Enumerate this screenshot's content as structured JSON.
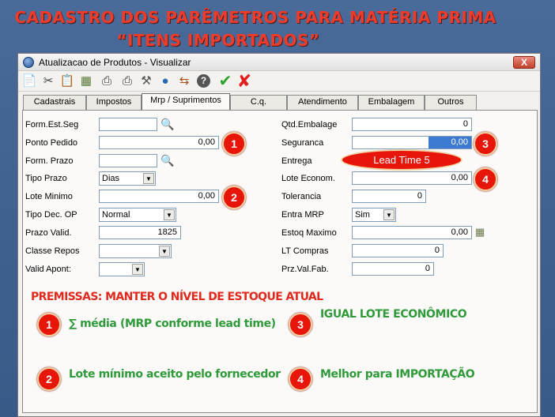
{
  "slide": {
    "title_line1": "CADASTRO DOS PARÊMETROS  PARA MATÉRIA PRIMA",
    "title_line2": "“ITENS IMPORTADOS”"
  },
  "window": {
    "title": "Atualizacao de Produtos - Visualizar",
    "close_label": "X"
  },
  "toolbar": {
    "icons": [
      "document-icon",
      "scissors-icon",
      "clipboard-icon",
      "money-icon",
      "printer-icon",
      "tools-icon",
      "globe-icon",
      "transfer-icon",
      "help-icon",
      "confirm-check-icon",
      "cancel-x-icon"
    ]
  },
  "tabs": [
    "Cadastrais",
    "Impostos",
    "Mrp / Suprimentos",
    "C.q.",
    "Atendimento",
    "Embalagem",
    "Outros"
  ],
  "active_tab": "Mrp / Suprimentos",
  "left_fields": {
    "form_est_seg": {
      "label": "Form.Est.Seg",
      "value": ""
    },
    "ponto_pedido": {
      "label": "Ponto Pedido",
      "value": "0,00"
    },
    "form_prazo": {
      "label": "Form. Prazo",
      "value": ""
    },
    "tipo_prazo": {
      "label": "Tipo Prazo",
      "value": "Dias"
    },
    "lote_minimo": {
      "label": "Lote Minimo",
      "value": "0,00"
    },
    "tipo_dec_op": {
      "label": "Tipo Dec. OP",
      "value": "Normal"
    },
    "prazo_valid": {
      "label": "Prazo Valid.",
      "value": "1825"
    },
    "classe_repos": {
      "label": "Classe Repos",
      "value": ""
    },
    "valid_apont": {
      "label": "Valid Apont:",
      "value": ""
    }
  },
  "right_fields": {
    "qtd_embalage": {
      "label": "Qtd.Embalage",
      "value": "0"
    },
    "seguranca": {
      "label": "Seguranca",
      "value": "0,00"
    },
    "entrega": {
      "label": "Entrega",
      "value": ""
    },
    "lote_econom": {
      "label": "Lote Econom.",
      "value": "0,00"
    },
    "tolerancia": {
      "label": "Tolerancia",
      "value": "0"
    },
    "entra_mrp": {
      "label": "Entra MRP",
      "value": "Sim"
    },
    "estoq_maximo": {
      "label": "Estoq Maximo",
      "value": "0,00"
    },
    "lt_compras": {
      "label": "LT Compras",
      "value": "0"
    },
    "prz_val_fab": {
      "label": "Prz.Val.Fab.",
      "value": "0"
    }
  },
  "callouts": {
    "lead_time": "Lead Time 5",
    "badge1": "1",
    "badge2": "2",
    "badge3": "3",
    "badge4": "4"
  },
  "notes": {
    "premissas": "PREMISSAS: MANTER O NÍVEL DE ESTOQUE ATUAL",
    "n1": "∑ média (MRP conforme lead time)",
    "n2": "Lote mínimo aceito pelo fornecedor",
    "n3": "IGUAL LOTE ECONÔMICO",
    "n4": "Melhor para IMPORTAÇÃO"
  }
}
